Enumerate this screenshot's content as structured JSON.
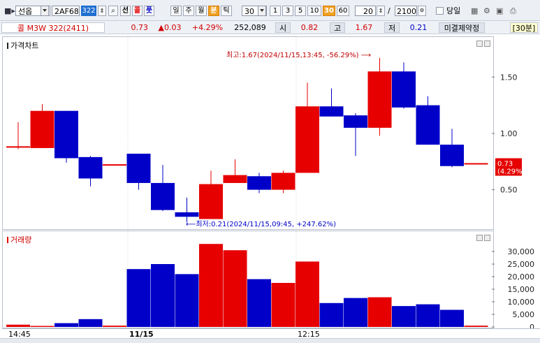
{
  "toolbar": {
    "market": "선옵",
    "code": "2AF68",
    "code_badge": "322",
    "buttons": {
      "seon": "선",
      "call": "콜",
      "put": "풋"
    },
    "periods": [
      "일",
      "주",
      "월",
      "분",
      "틱"
    ],
    "active_period": "분",
    "interval_value": "30",
    "quick_intervals": [
      "1",
      "3",
      "5",
      "10",
      "30",
      "60"
    ],
    "active_quick": "30",
    "count": "20",
    "separator": "/",
    "total": "2100",
    "today_label": "당일"
  },
  "quote": {
    "name": "콜 M3W 322(2411)",
    "price": "0.73",
    "change": "▲0.03",
    "change_pct": "+4.29%",
    "volume": "252,089",
    "open_label": "시",
    "open": "0.82",
    "high_label": "고",
    "high": "1.67",
    "low_label": "저",
    "low": "0.21",
    "oi_label": "미결제약정",
    "timeframe": "[30분]"
  },
  "price_chart": {
    "title": "가격차트",
    "high_annotation": "최고:1.67(2024/11/15,13:45, -56.29%)",
    "low_annotation": "최저:0.21(2024/11/15,09:45, +247.62%)",
    "current_price": "0.73",
    "current_pct": "(4.29%)"
  },
  "volume_chart": {
    "title": "거래량"
  },
  "x_labels": [
    "14:45",
    "11/15",
    "12:15"
  ],
  "colors": {
    "up": "#e60000",
    "down": "#0000c8",
    "accent": "#f0a020"
  },
  "chart_data": [
    {
      "type": "candlestick",
      "title": "가격차트",
      "ylim": [
        0.2,
        1.75
      ],
      "yticks": [
        0.5,
        1.0,
        1.5
      ],
      "candles": [
        {
          "o": 0.88,
          "h": 1.1,
          "l": 0.86,
          "c": 0.88
        },
        {
          "o": 0.87,
          "h": 1.26,
          "l": 0.87,
          "c": 1.2
        },
        {
          "o": 1.2,
          "h": 1.2,
          "l": 0.74,
          "c": 0.78
        },
        {
          "o": 0.79,
          "h": 0.8,
          "l": 0.53,
          "c": 0.6
        },
        {
          "o": 0.72,
          "h": 0.72,
          "l": 0.72,
          "c": 0.72
        },
        {
          "o": 0.82,
          "h": 0.82,
          "l": 0.5,
          "c": 0.56
        },
        {
          "o": 0.56,
          "h": 0.72,
          "l": 0.31,
          "c": 0.32
        },
        {
          "o": 0.3,
          "h": 0.43,
          "l": 0.21,
          "c": 0.26
        },
        {
          "o": 0.24,
          "h": 0.67,
          "l": 0.24,
          "c": 0.55
        },
        {
          "o": 0.56,
          "h": 0.77,
          "l": 0.56,
          "c": 0.63
        },
        {
          "o": 0.62,
          "h": 0.65,
          "l": 0.47,
          "c": 0.5
        },
        {
          "o": 0.5,
          "h": 0.67,
          "l": 0.47,
          "c": 0.65
        },
        {
          "o": 0.65,
          "h": 1.45,
          "l": 0.65,
          "c": 1.24
        },
        {
          "o": 1.24,
          "h": 1.4,
          "l": 1.15,
          "c": 1.15
        },
        {
          "o": 1.16,
          "h": 1.18,
          "l": 0.8,
          "c": 1.05
        },
        {
          "o": 1.05,
          "h": 1.67,
          "l": 0.98,
          "c": 1.55
        },
        {
          "o": 1.55,
          "h": 1.63,
          "l": 1.22,
          "c": 1.23
        },
        {
          "o": 1.25,
          "h": 1.33,
          "l": 0.9,
          "c": 0.9
        },
        {
          "o": 0.9,
          "h": 1.04,
          "l": 0.7,
          "c": 0.71
        },
        {
          "o": 0.73,
          "h": 0.73,
          "l": 0.73,
          "c": 0.73
        }
      ]
    },
    {
      "type": "bar",
      "title": "거래량",
      "ylim": [
        0,
        35000
      ],
      "yticks": [
        0,
        5000,
        10000,
        15000,
        20000,
        25000,
        30000
      ],
      "values": [
        900,
        400,
        1500,
        3100,
        500,
        23000,
        25000,
        21000,
        33000,
        30500,
        19000,
        17500,
        26000,
        9500,
        11500,
        11800,
        8300,
        9000,
        6800,
        500
      ]
    }
  ]
}
